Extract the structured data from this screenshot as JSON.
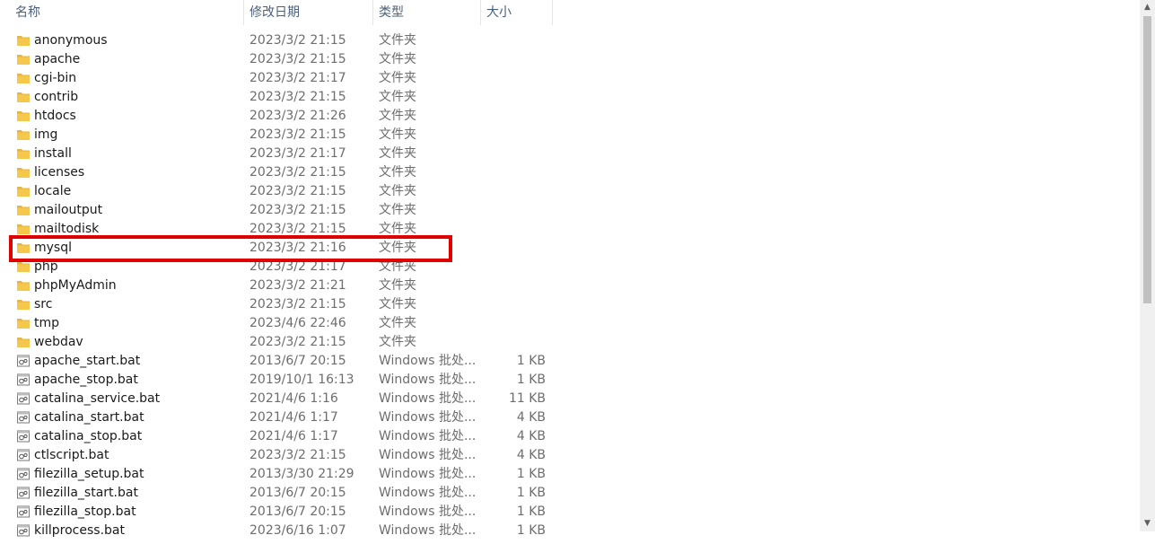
{
  "columns": {
    "name": "名称",
    "date": "修改日期",
    "type": "类型",
    "size": "大小"
  },
  "icons": {
    "folder": "folder-icon",
    "bat": "batch-file-icon",
    "folder_color": "#f5c84c",
    "folder_tab_color": "#e8b53a"
  },
  "highlight_color": "#e00000",
  "files": [
    {
      "name": "anonymous",
      "date": "2023/3/2 21:15",
      "type": "文件夹",
      "size": "",
      "kind": "folder"
    },
    {
      "name": "apache",
      "date": "2023/3/2 21:15",
      "type": "文件夹",
      "size": "",
      "kind": "folder"
    },
    {
      "name": "cgi-bin",
      "date": "2023/3/2 21:17",
      "type": "文件夹",
      "size": "",
      "kind": "folder"
    },
    {
      "name": "contrib",
      "date": "2023/3/2 21:15",
      "type": "文件夹",
      "size": "",
      "kind": "folder"
    },
    {
      "name": "htdocs",
      "date": "2023/3/2 21:26",
      "type": "文件夹",
      "size": "",
      "kind": "folder"
    },
    {
      "name": "img",
      "date": "2023/3/2 21:15",
      "type": "文件夹",
      "size": "",
      "kind": "folder"
    },
    {
      "name": "install",
      "date": "2023/3/2 21:17",
      "type": "文件夹",
      "size": "",
      "kind": "folder"
    },
    {
      "name": "licenses",
      "date": "2023/3/2 21:15",
      "type": "文件夹",
      "size": "",
      "kind": "folder"
    },
    {
      "name": "locale",
      "date": "2023/3/2 21:15",
      "type": "文件夹",
      "size": "",
      "kind": "folder"
    },
    {
      "name": "mailoutput",
      "date": "2023/3/2 21:15",
      "type": "文件夹",
      "size": "",
      "kind": "folder"
    },
    {
      "name": "mailtodisk",
      "date": "2023/3/2 21:15",
      "type": "文件夹",
      "size": "",
      "kind": "folder"
    },
    {
      "name": "mysql",
      "date": "2023/3/2 21:16",
      "type": "文件夹",
      "size": "",
      "kind": "folder"
    },
    {
      "name": "php",
      "date": "2023/3/2 21:17",
      "type": "文件夹",
      "size": "",
      "kind": "folder"
    },
    {
      "name": "phpMyAdmin",
      "date": "2023/3/2 21:21",
      "type": "文件夹",
      "size": "",
      "kind": "folder"
    },
    {
      "name": "src",
      "date": "2023/3/2 21:15",
      "type": "文件夹",
      "size": "",
      "kind": "folder"
    },
    {
      "name": "tmp",
      "date": "2023/4/6 22:46",
      "type": "文件夹",
      "size": "",
      "kind": "folder"
    },
    {
      "name": "webdav",
      "date": "2023/3/2 21:15",
      "type": "文件夹",
      "size": "",
      "kind": "folder"
    },
    {
      "name": "apache_start.bat",
      "date": "2013/6/7 20:15",
      "type": "Windows 批处...",
      "size": "1 KB",
      "kind": "bat"
    },
    {
      "name": "apache_stop.bat",
      "date": "2019/10/1 16:13",
      "type": "Windows 批处...",
      "size": "1 KB",
      "kind": "bat"
    },
    {
      "name": "catalina_service.bat",
      "date": "2021/4/6 1:16",
      "type": "Windows 批处...",
      "size": "11 KB",
      "kind": "bat"
    },
    {
      "name": "catalina_start.bat",
      "date": "2021/4/6 1:17",
      "type": "Windows 批处...",
      "size": "4 KB",
      "kind": "bat"
    },
    {
      "name": "catalina_stop.bat",
      "date": "2021/4/6 1:17",
      "type": "Windows 批处...",
      "size": "4 KB",
      "kind": "bat"
    },
    {
      "name": "ctlscript.bat",
      "date": "2023/3/2 21:15",
      "type": "Windows 批处...",
      "size": "4 KB",
      "kind": "bat"
    },
    {
      "name": "filezilla_setup.bat",
      "date": "2013/3/30 21:29",
      "type": "Windows 批处...",
      "size": "1 KB",
      "kind": "bat"
    },
    {
      "name": "filezilla_start.bat",
      "date": "2013/6/7 20:15",
      "type": "Windows 批处...",
      "size": "1 KB",
      "kind": "bat"
    },
    {
      "name": "filezilla_stop.bat",
      "date": "2013/6/7 20:15",
      "type": "Windows 批处...",
      "size": "1 KB",
      "kind": "bat"
    },
    {
      "name": "killprocess.bat",
      "date": "2023/6/16 1:07",
      "type": "Windows 批处...",
      "size": "1 KB",
      "kind": "bat"
    }
  ]
}
